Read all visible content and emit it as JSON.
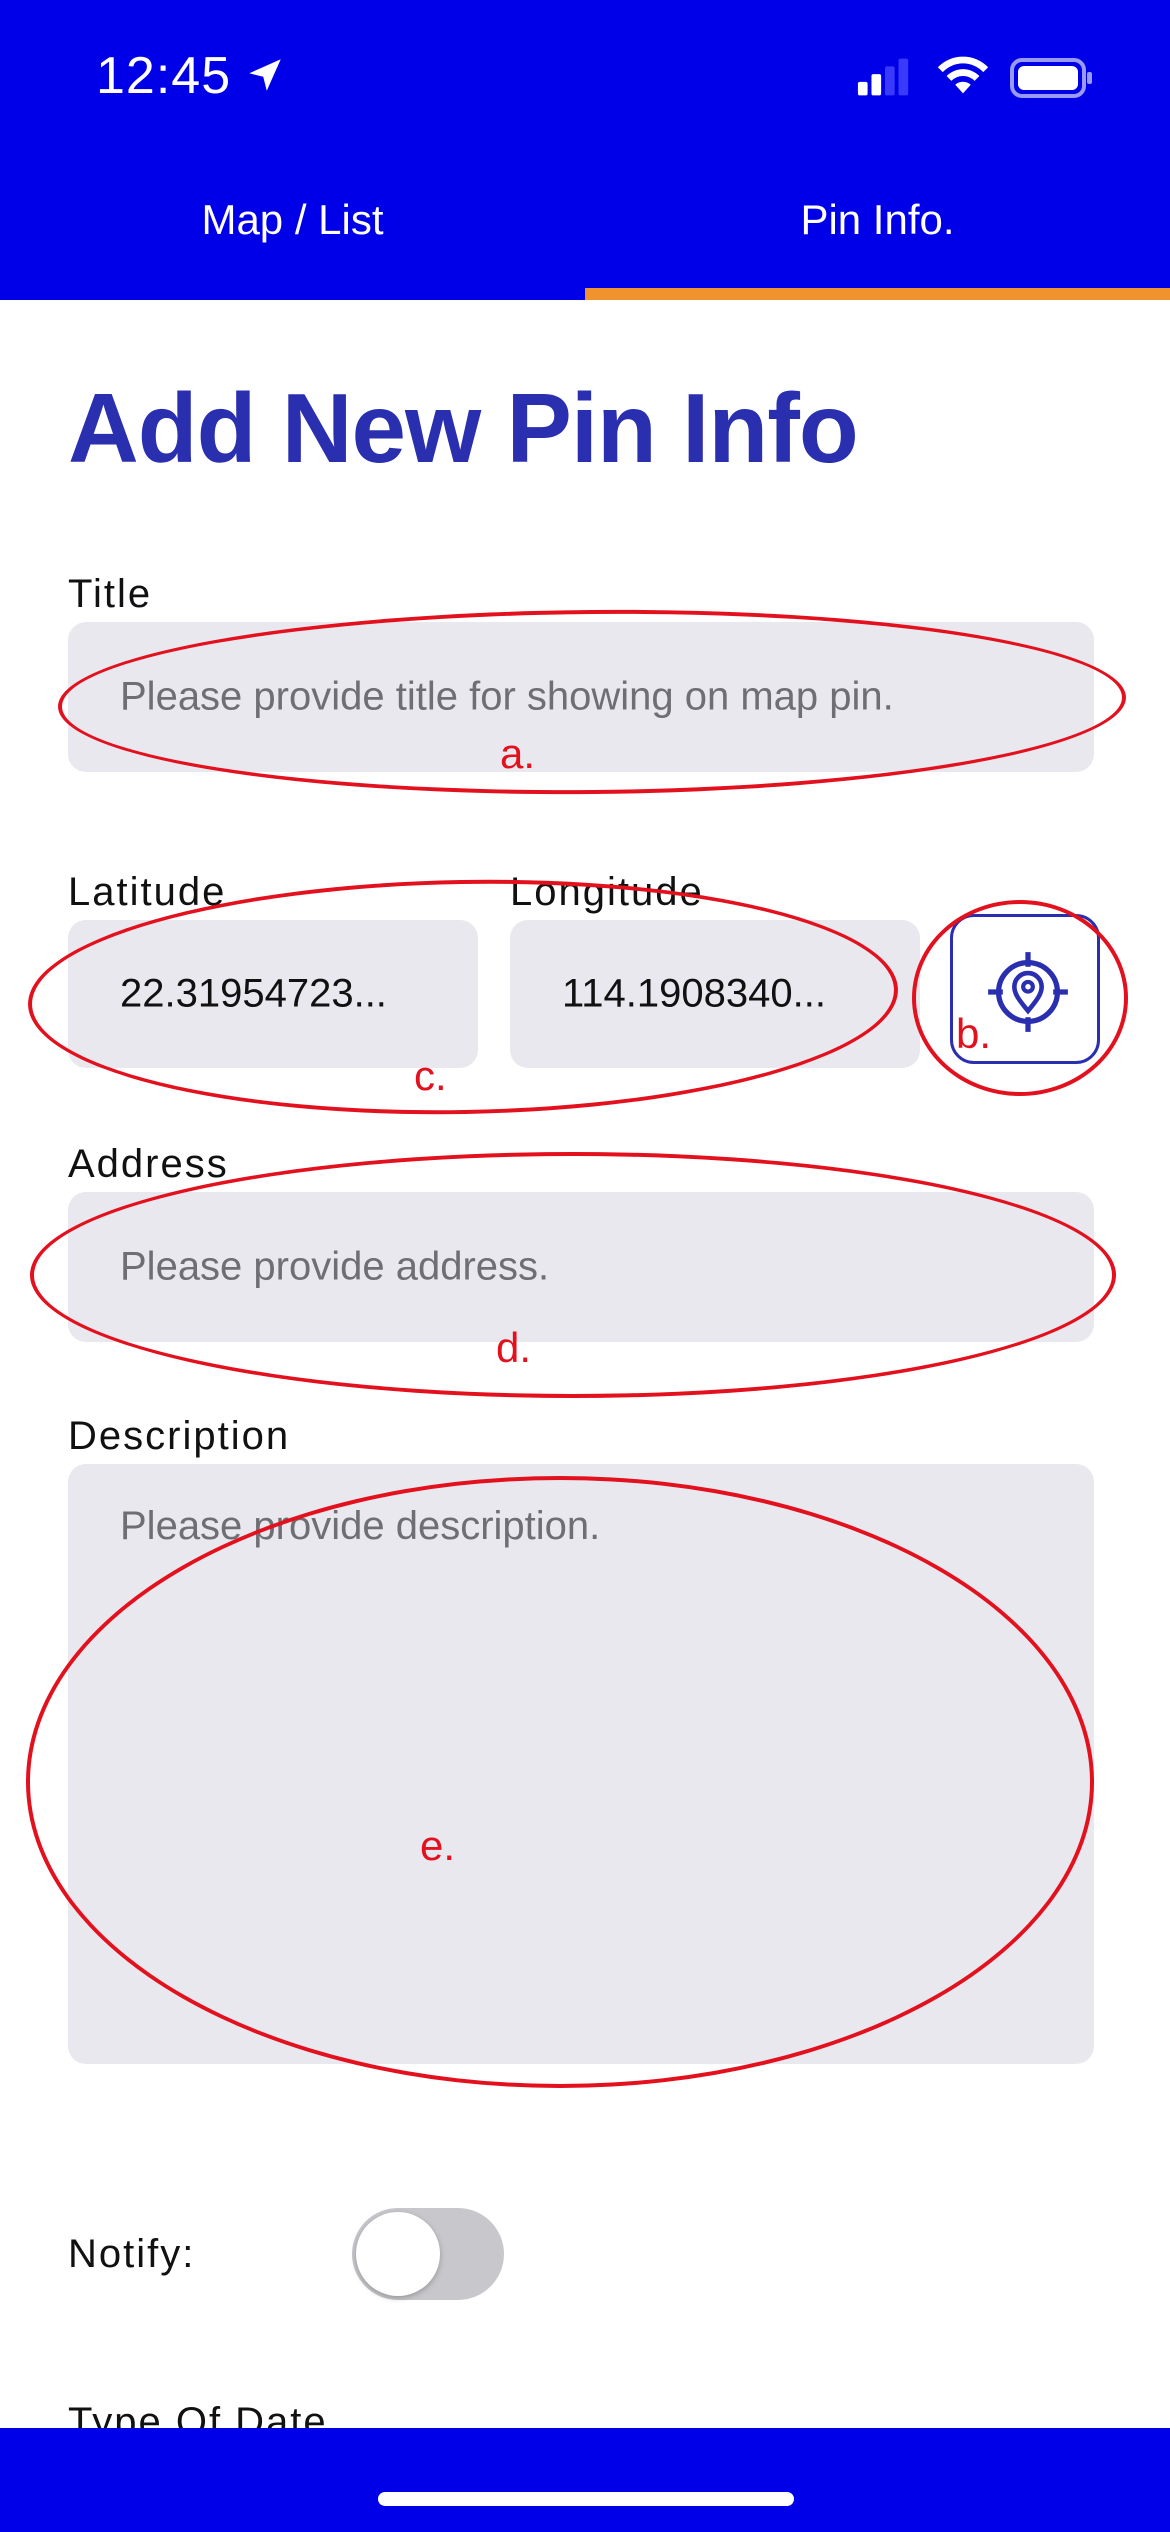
{
  "status_bar": {
    "time": "12:45"
  },
  "tabs": [
    {
      "label": "Map / List",
      "selected": false
    },
    {
      "label": "Pin Info.",
      "selected": true
    }
  ],
  "page": {
    "title": "Add New Pin Info"
  },
  "form": {
    "title": {
      "label": "Title",
      "placeholder": "Please provide title for showing on map pin.",
      "value": ""
    },
    "latitude": {
      "label": "Latitude",
      "value": "22.31954723..."
    },
    "longitude": {
      "label": "Longitude",
      "value": "114.1908340..."
    },
    "locate_button": {
      "icon": "locate-pin-icon"
    },
    "address": {
      "label": "Address",
      "placeholder": "Please provide address.",
      "value": ""
    },
    "description": {
      "label": "Description",
      "placeholder": "Please provide description.",
      "value": ""
    },
    "notify": {
      "label": "Notify:",
      "on": false
    },
    "type_of_date": {
      "label": "Type Of Date"
    }
  },
  "annotations": {
    "a": "a.",
    "b": "b.",
    "c": "c.",
    "d": "d.",
    "e": "e."
  },
  "colors": {
    "header": "#0000e8",
    "tab_indicator": "#f0922d",
    "title_text": "#2a2fb0",
    "field_bg": "#e8e8ee",
    "annotation": "#e3101e"
  }
}
